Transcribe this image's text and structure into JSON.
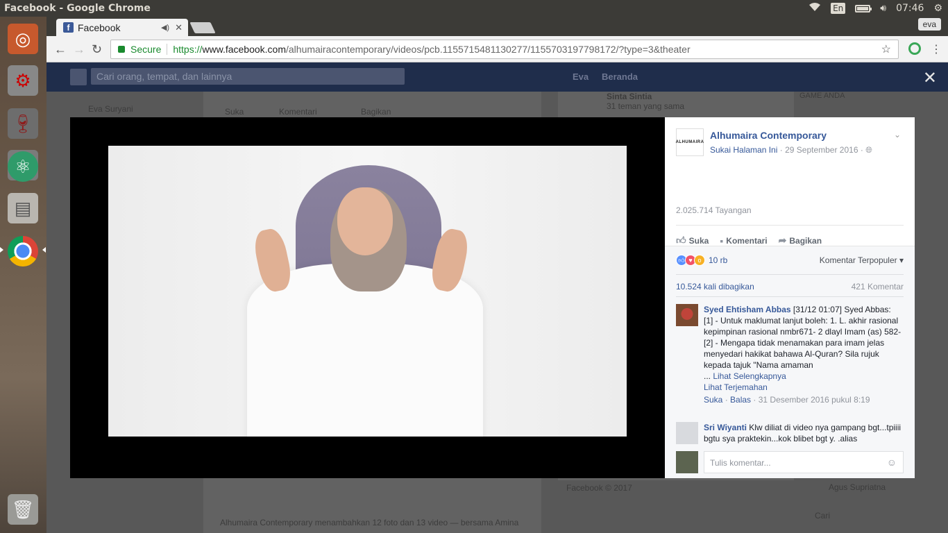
{
  "os": {
    "window_title": "Facebook - Google Chrome",
    "tray": {
      "language": "En",
      "battery_level": 0.85,
      "clock": "07:46"
    },
    "launcher": [
      "ubuntu-dash",
      "system-settings",
      "wine",
      "system-tools",
      "atom-editor",
      "file-manager",
      "chrome",
      "trash"
    ]
  },
  "browser": {
    "tab": {
      "title": "Facebook"
    },
    "user": "eva",
    "omnibox": {
      "secure_label": "Secure",
      "scheme": "https://",
      "host": "www.facebook.com",
      "path": "/alhumairacontemporary/videos/pcb.1155715481130277/1155703197798172/?type=3&theater"
    }
  },
  "fb_background": {
    "search_placeholder": "Cari orang, tempat, dan lainnya",
    "nav_user": "Eva",
    "nav_home": "Beranda",
    "left_user": "Eva Suryani",
    "bg_like": "Suka",
    "bg_comment": "Komentari",
    "bg_share": "Bagikan",
    "suggest_name": "Sinta Sintia",
    "suggest_mutual": "31 teman yang sama",
    "game_heading": "GAME ANDA",
    "footer": "Facebook © 2017",
    "chat_friend": "Agus Supriatna",
    "chat_search": "Cari",
    "bg_post": "Alhumaira Contemporary menambahkan 12 foto dan 13 video — bersama Amina"
  },
  "post": {
    "page_name": "Alhumaira Contemporary",
    "logo_text": "ALHUMAIRA",
    "like_page": "Sukai Halaman Ini",
    "date": "29 September 2016",
    "views": "2.025.714 Tayangan",
    "actions": {
      "like": "Suka",
      "comment": "Komentari",
      "share": "Bagikan"
    },
    "reaction_count": "10 rb",
    "sort_label": "Komentar Terpopuler",
    "shares": "10.524 kali dibagikan",
    "comment_count": "421 Komentar",
    "comments": [
      {
        "name": "Syed Ehtisham Abbas",
        "lines": [
          " [31/12 01:07] Syed Abbas:",
          "[1] - Untuk maklumat lanjut boleh: 1. L. akhir rasional kepimpinan rasional nmbr671- 2 dlayl Imam (as) 582-",
          "[2] - Mengapa tidak menamakan para imam jelas menyedari hakikat bahawa Al-Quran? Sila rujuk kepada tajuk \"Nama amaman"
        ],
        "see_more_prefix": "... ",
        "see_more": "Lihat Selengkapnya",
        "see_translation": "Lihat Terjemahan",
        "like": "Suka",
        "reply": "Balas",
        "timestamp": "31 Desember 2016 pukul 8:19"
      },
      {
        "name": "Sri Wiyanti",
        "text": " Klw diliat di video nya gampang bgt...tpiiii bgtu sya praktekin...kok blibet bgt y. .alias"
      }
    ],
    "composer_placeholder": "Tulis komentar..."
  }
}
